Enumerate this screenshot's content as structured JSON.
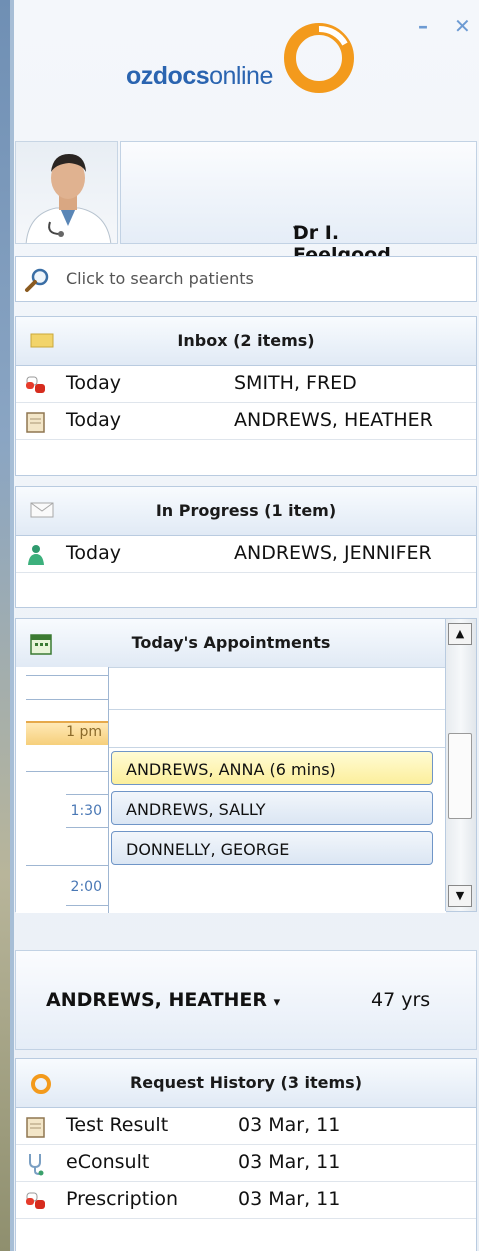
{
  "window": {
    "minimize": "–",
    "close": "✕"
  },
  "logo": {
    "part1": "ozdocs",
    "part2": "online"
  },
  "doctor": {
    "name": "Dr I. Feelgood",
    "caret": "▾"
  },
  "search": {
    "placeholder": "Click to search patients"
  },
  "inbox": {
    "title": "Inbox (2 items)",
    "rows": [
      {
        "icon": "pill-icon",
        "when": "Today",
        "patient": "SMITH, FRED"
      },
      {
        "icon": "clipboard-icon",
        "when": "Today",
        "patient": "ANDREWS, HEATHER"
      }
    ]
  },
  "in_progress": {
    "title": "In Progress (1 item)",
    "rows": [
      {
        "icon": "person-icon",
        "when": "Today",
        "patient": "ANDREWS, JENNIFER"
      }
    ]
  },
  "appointments": {
    "title": "Today's Appointments",
    "times": [
      "1 pm",
      "1:30",
      "2:00"
    ],
    "items": [
      {
        "label": "ANDREWS, ANNA (6 mins)",
        "highlight": true
      },
      {
        "label": "ANDREWS, SALLY",
        "highlight": false
      },
      {
        "label": "DONNELLY, GEORGE",
        "highlight": false
      }
    ]
  },
  "patient": {
    "name": "ANDREWS, HEATHER",
    "caret": "▾",
    "age": "47 yrs"
  },
  "history": {
    "title": "Request History (3 items)",
    "rows": [
      {
        "icon": "clipboard-icon",
        "type": "Test Result",
        "date": "03 Mar, 11"
      },
      {
        "icon": "stethoscope-icon",
        "type": "eConsult",
        "date": "03 Mar, 11"
      },
      {
        "icon": "pill-icon",
        "type": "Prescription",
        "date": "03 Mar, 11"
      }
    ]
  },
  "colors": {
    "accent": "#2a64b0",
    "orange": "#f39a1c",
    "highlight": "#fcef9c"
  }
}
